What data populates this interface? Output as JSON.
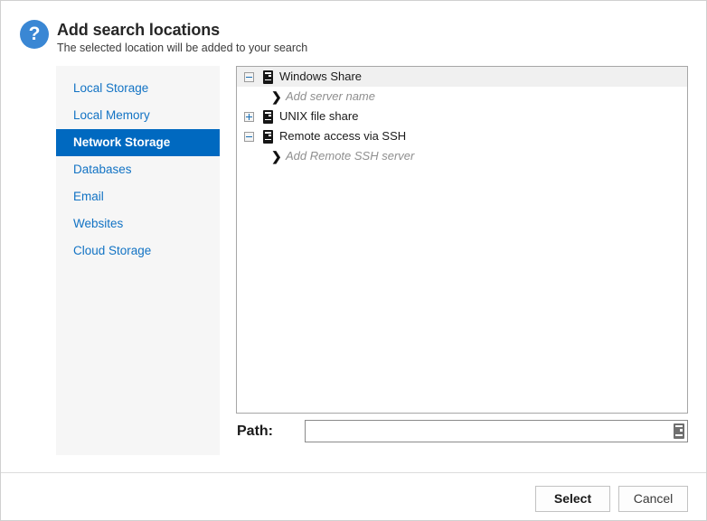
{
  "header": {
    "help_icon": "question-mark-icon",
    "title": "Add search locations",
    "subtitle": "The selected location will be added to your search"
  },
  "sidebar": {
    "items": [
      {
        "label": "Local Storage",
        "selected": false
      },
      {
        "label": "Local Memory",
        "selected": false
      },
      {
        "label": "Network Storage",
        "selected": true
      },
      {
        "label": "Databases",
        "selected": false
      },
      {
        "label": "Email",
        "selected": false
      },
      {
        "label": "Websites",
        "selected": false
      },
      {
        "label": "Cloud Storage",
        "selected": false
      }
    ],
    "selected_label": "Network Storage"
  },
  "tree": {
    "rows": [
      {
        "label": "Windows Share",
        "toggle": "minus",
        "icon": "server-icon",
        "type": "parent",
        "selected": true
      },
      {
        "label": "Add server name",
        "toggle": "none",
        "icon": "chevron-right-icon",
        "type": "child",
        "selected": false
      },
      {
        "label": "UNIX file share",
        "toggle": "plus",
        "icon": "server-icon",
        "type": "parent",
        "selected": false
      },
      {
        "label": "Remote access via SSH",
        "toggle": "minus",
        "icon": "server-icon",
        "type": "parent",
        "selected": false
      },
      {
        "label": "Add Remote SSH server",
        "toggle": "none",
        "icon": "chevron-right-icon",
        "type": "child",
        "selected": false
      }
    ],
    "chevron_glyph": "❯"
  },
  "path": {
    "label": "Path:",
    "value": "",
    "placeholder": "",
    "browse_icon": "server-icon"
  },
  "footer": {
    "select_label": "Select",
    "cancel_label": "Cancel"
  },
  "colors": {
    "accent_blue": "#0069c0",
    "link_blue": "#1273c4",
    "help_icon_blue": "#3a87d4",
    "sidebar_background": "#f6f6f6",
    "panel_border": "#a6a6a6",
    "selected_row": "#f0f0f0"
  }
}
